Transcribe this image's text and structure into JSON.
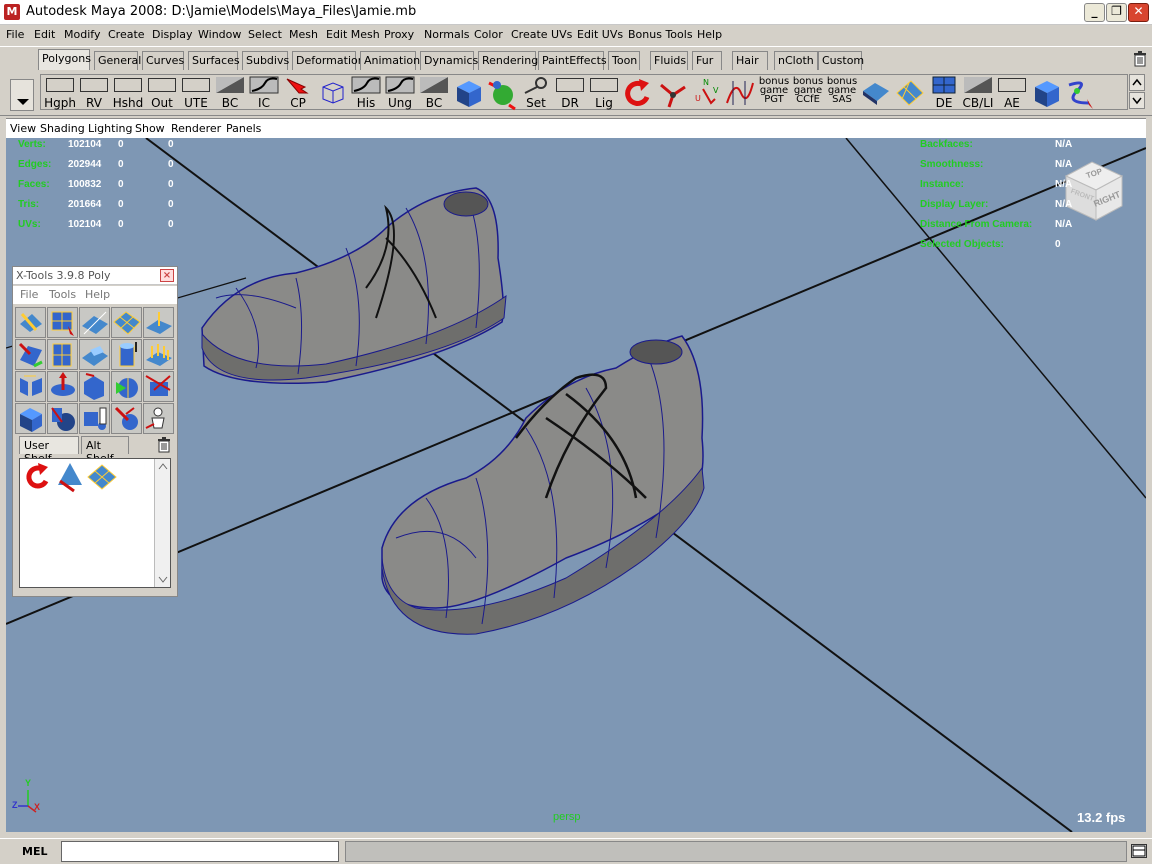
{
  "window": {
    "title": "Autodesk Maya 2008: D:\\Jamie\\Models\\Maya_Files\\Jamie.mb",
    "app_icon": "M",
    "minimize": "_",
    "maximize": "❐",
    "close": "✕"
  },
  "menubar": [
    "File",
    "Edit",
    "Modify",
    "Create",
    "Display",
    "Window",
    "Select",
    "Mesh",
    "Edit Mesh",
    "Proxy",
    "Normals",
    "Color",
    "Create UVs",
    "Edit UVs",
    "Bonus Tools",
    "Help"
  ],
  "shelf": {
    "tabs": [
      "Polygons",
      "General",
      "Curves",
      "Surfaces",
      "Subdivs",
      "Deformation",
      "Animation",
      "Dynamics",
      "Rendering",
      "PaintEffects",
      "Toon",
      "Fluids",
      "Fur",
      "Hair",
      "nCloth",
      "Custom"
    ],
    "active_tab": "Polygons",
    "icons": [
      {
        "label": "Hgph"
      },
      {
        "label": "RV"
      },
      {
        "label": "Hshd"
      },
      {
        "label": "Out"
      },
      {
        "label": "UTE"
      },
      {
        "label": "BC"
      },
      {
        "label": "IC"
      },
      {
        "label": "CP"
      },
      {
        "label": ""
      },
      {
        "label": "His"
      },
      {
        "label": "Ung"
      },
      {
        "label": "BC"
      },
      {
        "label": ""
      },
      {
        "label": ""
      },
      {
        "label": "Set"
      },
      {
        "label": "DR"
      },
      {
        "label": "Lig"
      },
      {
        "label": ""
      },
      {
        "label": ""
      },
      {
        "label": ""
      },
      {
        "label": ""
      },
      {
        "label": "bonus game PGT"
      },
      {
        "label": "bonus game CCfE"
      },
      {
        "label": "bonus game SAS"
      },
      {
        "label": ""
      },
      {
        "label": ""
      },
      {
        "label": "DE"
      },
      {
        "label": "CB/LI"
      },
      {
        "label": "AE"
      },
      {
        "label": ""
      },
      {
        "label": ""
      }
    ]
  },
  "panel_menu": [
    "View",
    "Shading",
    "Lighting",
    "Show",
    "Renderer",
    "Panels"
  ],
  "hud_left": [
    {
      "label": "Verts:",
      "a": "102104",
      "b": "0",
      "c": "0"
    },
    {
      "label": "Edges:",
      "a": "202944",
      "b": "0",
      "c": "0"
    },
    {
      "label": "Faces:",
      "a": "100832",
      "b": "0",
      "c": "0"
    },
    {
      "label": "Tris:",
      "a": "201664",
      "b": "0",
      "c": "0"
    },
    {
      "label": "UVs:",
      "a": "102104",
      "b": "0",
      "c": "0"
    }
  ],
  "hud_right": [
    {
      "label": "Backfaces:",
      "value": "N/A"
    },
    {
      "label": "Smoothness:",
      "value": "N/A"
    },
    {
      "label": "Instance:",
      "value": "N/A"
    },
    {
      "label": "Display Layer:",
      "value": "N/A"
    },
    {
      "label": "Distance From Camera:",
      "value": "N/A"
    },
    {
      "label": "Selected Objects:",
      "value": "0"
    }
  ],
  "viewcube": {
    "top": "TOP",
    "right": "RIGHT",
    "front": "FRONT"
  },
  "camera": "persp",
  "fps": "13.2 fps",
  "axis": {
    "y": "Y",
    "z": "Z",
    "x": "X"
  },
  "xtools": {
    "title": "X-Tools 3.9.8 Poly",
    "close": "×",
    "menu": [
      "File",
      "Tools",
      "Help"
    ],
    "tabs": [
      "User Shelf",
      "Alt Shelf"
    ],
    "active_tab": "User Shelf"
  },
  "cmdline": {
    "label": "MEL",
    "value": "",
    "output": ""
  },
  "colors": {
    "viewport": "#7e97b4",
    "hud_label": "#22cc22",
    "hud_value": "#ffffff",
    "wire": "#1a1a8c",
    "shoe": "#8a8a88"
  }
}
